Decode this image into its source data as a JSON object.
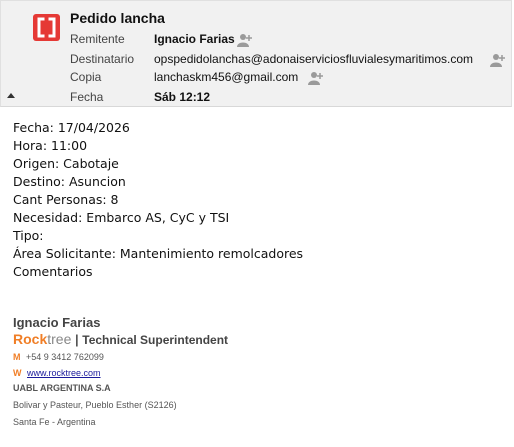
{
  "header": {
    "subject": "Pedido lancha",
    "rows": [
      {
        "label": "Remitente",
        "value": "Ignacio Farias"
      },
      {
        "label": "Destinatario",
        "value": "opspedidolanchas@adonaiserviciosfluvialesymaritimos.com"
      },
      {
        "label": "Copia",
        "value": "lanchaskm456@gmail.com"
      },
      {
        "label": "Fecha",
        "value": "Sáb 12:12"
      }
    ],
    "icons": {
      "logo": "app-logo-icon",
      "person": "add-contact-icon",
      "collapse": "collapse-triangle-icon"
    },
    "colors": {
      "logo": "#e53935",
      "header_bg": "#f1f1f1"
    }
  },
  "body": {
    "lines": [
      "Fecha: 17/04/2026",
      "Hora: 11:00",
      "Origen: Cabotaje",
      "Destino: Asuncion",
      "Cant Personas: 8",
      "Necesidad: Embarco AS, CyC y TSI",
      "Tipo:",
      "Área Solicitante: Mantenimiento remolcadores",
      "Comentarios"
    ]
  },
  "signature": {
    "name": "Ignacio Farias",
    "brand_rock": "Rock",
    "brand_tree": "tree",
    "separator": "|",
    "title": "Technical Superintendent",
    "mobile_key": "M",
    "mobile": "+54 9 3412 762099",
    "web_key": "W",
    "web": "www.rocktree.com",
    "company": "UABL ARGENTINA S.A",
    "address1": "Bolivar y Pasteur, Pueblo Esther (S2126)",
    "address2": "Santa Fe - Argentina",
    "colors": {
      "accent": "#f07e26",
      "link": "#1a1a9c"
    }
  }
}
